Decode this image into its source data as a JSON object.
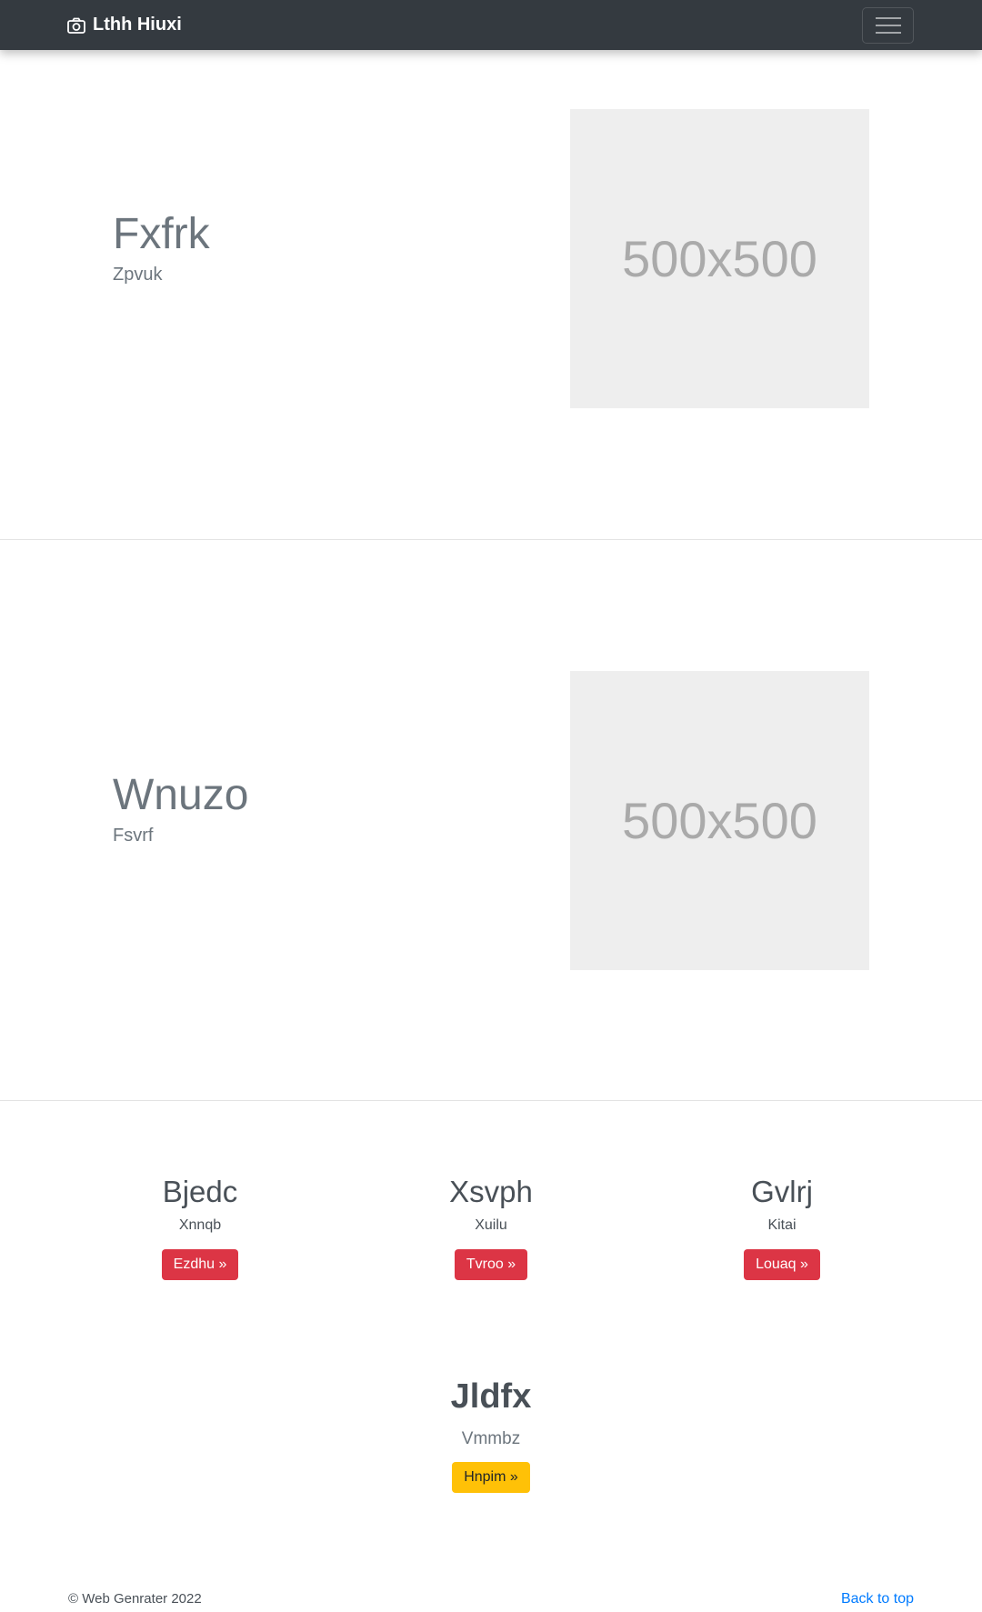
{
  "navbar": {
    "brand": "Lthh Hiuxi"
  },
  "featurettes": [
    {
      "heading": "Fxfrk",
      "subheading": "Zpvuk",
      "image_label": "500x500"
    },
    {
      "heading": "Wnuzo",
      "subheading": "Fsvrf",
      "image_label": "500x500"
    }
  ],
  "columns": [
    {
      "title": "Bjedc",
      "text": "Xnnqb",
      "button": "Ezdhu »"
    },
    {
      "title": "Xsvph",
      "text": "Xuilu",
      "button": "Tvroo »"
    },
    {
      "title": "Gvlrj",
      "text": "Kitai",
      "button": "Louaq »"
    }
  ],
  "highlight": {
    "title": "Jldfx",
    "text": "Vmmbz",
    "button": "Hnpim »"
  },
  "footer": {
    "copyright": "© Web Genrater 2022",
    "back_to_top": "Back to top"
  },
  "colors": {
    "navbar_bg": "#343a40",
    "danger": "#dc3545",
    "warning": "#ffc107",
    "link": "#007bff",
    "placeholder_bg": "#eeeeee"
  },
  "icons": {
    "brand": "camera-icon",
    "toggler": "hamburger-menu-icon"
  }
}
